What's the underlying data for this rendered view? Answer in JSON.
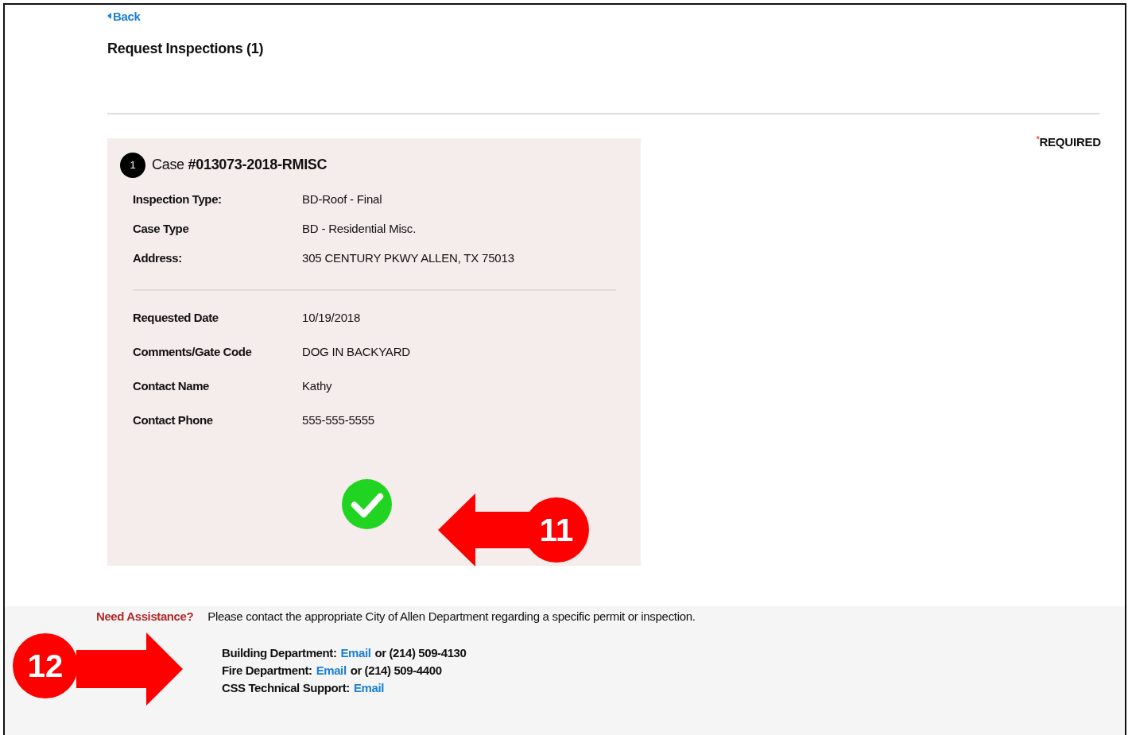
{
  "back_link": "Back",
  "title": "Request Inspections (1)",
  "required_note": {
    "mark": "*",
    "label": "REQUIRED"
  },
  "case": {
    "number": "1",
    "prefix": "Case",
    "case_id": "#013073-2018-RMISC",
    "complete": true,
    "details": [
      {
        "label": "Inspection Type:",
        "value": "BD-Roof - Final"
      },
      {
        "label": "Case Type",
        "value": "BD - Residential Misc."
      },
      {
        "label": "Address:",
        "value": "305 CENTURY PKWY ALLEN, TX 75013"
      }
    ],
    "request": [
      {
        "label": "Requested Date",
        "value": "10/19/2018"
      },
      {
        "label": "Comments/Gate Code",
        "value": "DOG IN BACKYARD"
      },
      {
        "label": "Contact Name",
        "value": "Kathy"
      },
      {
        "label": "Contact Phone",
        "value": "555-555-5555"
      }
    ]
  },
  "footer": {
    "heading": "Need Assistance?",
    "message": "Please contact the appropriate City of Allen Department regarding a specific permit or inspection.",
    "contacts": [
      {
        "label": "Building Department:",
        "link": "Email",
        "phone": "or (214) 509-4130"
      },
      {
        "label": "Fire Department:",
        "link": "Email",
        "phone": "or (214) 509-4400"
      },
      {
        "label": "CSS Technical Support:",
        "link": "Email"
      }
    ]
  },
  "callouts": [
    {
      "label": "11",
      "kind": "left"
    },
    {
      "label": "12",
      "kind": "right"
    }
  ]
}
